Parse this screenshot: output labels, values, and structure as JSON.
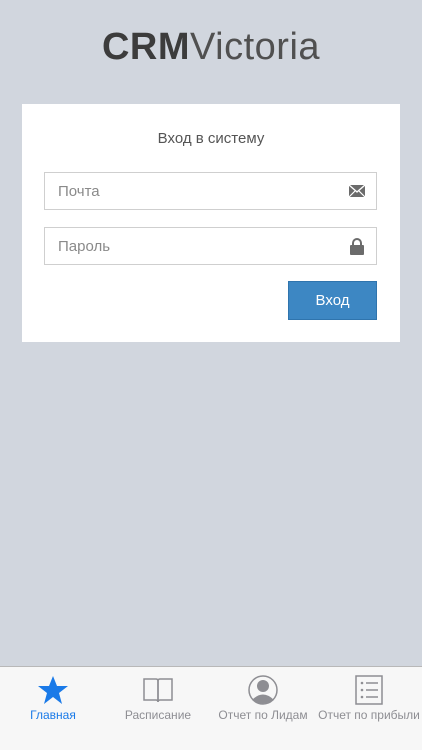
{
  "app": {
    "logo_bold": "CRM",
    "logo_light": "Victoria"
  },
  "login": {
    "title": "Вход в систему",
    "email_placeholder": "Почта",
    "email_value": "",
    "password_placeholder": "Пароль",
    "password_value": "",
    "submit_label": "Вход",
    "email_icon": "envelope-icon",
    "password_icon": "lock-icon"
  },
  "tabbar": {
    "tabs": [
      {
        "label": "Главная",
        "icon": "star-icon",
        "active": true
      },
      {
        "label": "Расписание",
        "icon": "book-icon",
        "active": false
      },
      {
        "label": "Отчет по Лидам",
        "icon": "person-icon",
        "active": false
      },
      {
        "label": "Отчет по прибыли",
        "icon": "list-icon",
        "active": false
      }
    ]
  },
  "colors": {
    "background": "#d1d6de",
    "accent": "#3d87c3",
    "tab_active": "#1a7ae8",
    "tab_inactive": "#8e8e93"
  }
}
